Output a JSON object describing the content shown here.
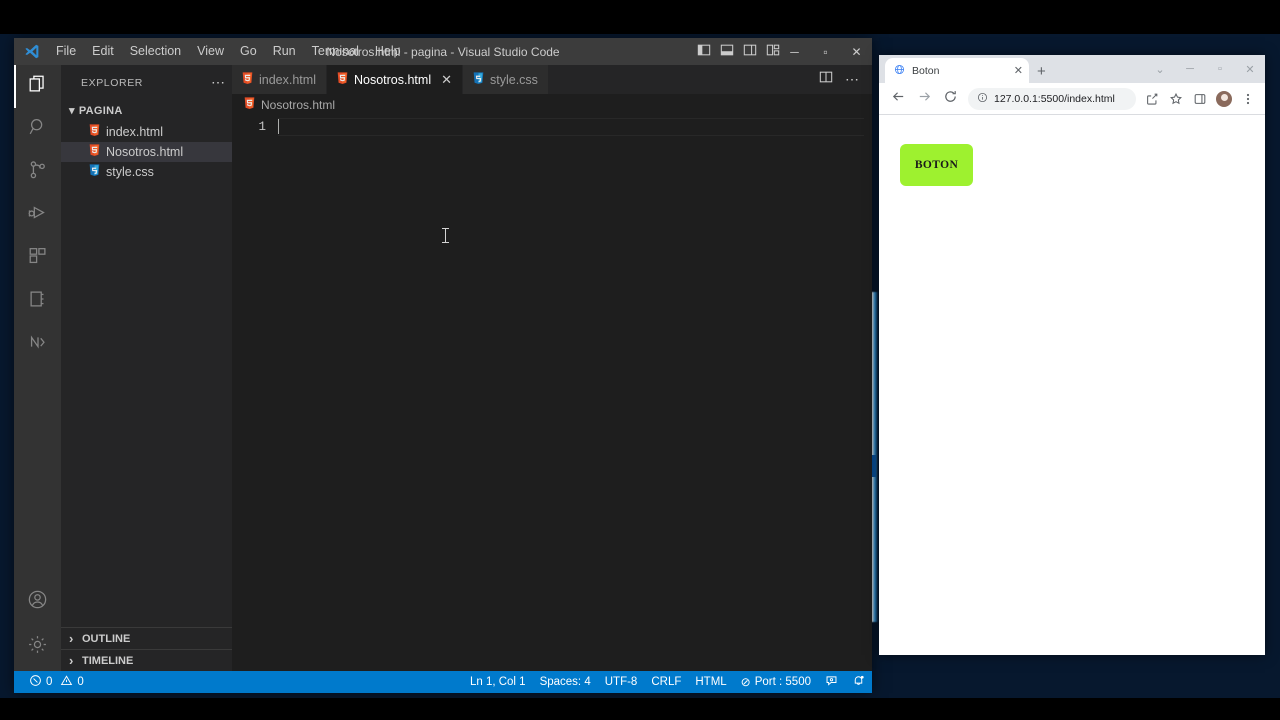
{
  "desktop": {
    "name": "windows-desktop"
  },
  "vscode": {
    "title": "Nosotros.html - pagina - Visual Studio Code",
    "logo_icon": "vscode-logo-icon",
    "menu": [
      {
        "label": "File"
      },
      {
        "label": "Edit"
      },
      {
        "label": "Selection"
      },
      {
        "label": "View"
      },
      {
        "label": "Go"
      },
      {
        "label": "Run"
      },
      {
        "label": "Terminal"
      },
      {
        "label": "Help"
      }
    ],
    "layout_icons": [
      {
        "name": "toggle-primary-sidebar-icon"
      },
      {
        "name": "toggle-panel-icon"
      },
      {
        "name": "toggle-secondary-sidebar-icon"
      },
      {
        "name": "customize-layout-icon"
      }
    ],
    "window_controls": {
      "minimize": "─",
      "maximize": "▫",
      "close": "✕"
    },
    "activitybar": [
      {
        "name": "explorer",
        "icon": "files-icon",
        "active": true
      },
      {
        "name": "search",
        "icon": "search-icon",
        "active": false
      },
      {
        "name": "source-control",
        "icon": "source-control-icon",
        "active": false
      },
      {
        "name": "run-and-debug",
        "icon": "run-debug-icon",
        "active": false
      },
      {
        "name": "extensions",
        "icon": "extensions-icon",
        "active": false
      },
      {
        "name": "notebook",
        "icon": "notebook-icon",
        "active": false
      },
      {
        "name": "nodejs-tool",
        "icon": "n-icon",
        "active": false
      }
    ],
    "activitybar_bottom": [
      {
        "name": "accounts",
        "icon": "account-icon"
      },
      {
        "name": "manage-settings",
        "icon": "gear-icon"
      }
    ],
    "sidebar": {
      "header": "EXPLORER",
      "header_more_icon": "ellipsis-icon",
      "folder": {
        "label": "PAGINA",
        "chevron": "⌄"
      },
      "files": [
        {
          "label": "index.html",
          "icon": "html5-icon",
          "selected": false
        },
        {
          "label": "Nosotros.html",
          "icon": "html5-icon",
          "selected": true
        },
        {
          "label": "style.css",
          "icon": "css3-icon",
          "selected": false
        }
      ],
      "sections": [
        {
          "label": "OUTLINE",
          "chevron": "›"
        },
        {
          "label": "TIMELINE",
          "chevron": "›"
        }
      ]
    },
    "editor": {
      "tabs": [
        {
          "label": "index.html",
          "icon": "html5-icon",
          "active": false,
          "close": ""
        },
        {
          "label": "Nosotros.html",
          "icon": "html5-icon",
          "active": true,
          "close": "✕"
        },
        {
          "label": "style.css",
          "icon": "css3-icon",
          "active": false,
          "close": ""
        }
      ],
      "actions": [
        {
          "name": "split-editor-right-icon"
        },
        {
          "name": "more-actions-icon"
        }
      ],
      "breadcrumb": {
        "label": "Nosotros.html",
        "icon": "html5-icon"
      },
      "line_numbers": [
        "1"
      ],
      "content_lines": [
        ""
      ]
    },
    "statusbar": {
      "errors_icon": "error-circle-icon",
      "errors": "0",
      "warnings_icon": "warning-triangle-icon",
      "warnings": "0",
      "cursor_position": "Ln 1, Col 1",
      "indentation": "Spaces: 4",
      "encoding": "UTF-8",
      "eol": "CRLF",
      "language": "HTML",
      "live_server_icon": "⊘",
      "live_server": "Port : 5500",
      "feedback_icon": "feedback-icon",
      "bell_icon": "bell-dot-icon",
      "accent_color": "#007acc"
    }
  },
  "browser": {
    "tab": {
      "title": "Boton",
      "favicon": "globe-icon",
      "close": "✕"
    },
    "new_tab_label": "+",
    "window_controls": {
      "tab_search": "⌄",
      "minimize": "─",
      "maximize": "▫",
      "close": "✕"
    },
    "nav": {
      "back_icon": "arrow-left-icon",
      "forward_icon": "arrow-right-icon",
      "reload_icon": "reload-icon"
    },
    "omnibox": {
      "info_icon": "info-circle-icon",
      "url": "127.0.0.1:5500/index.html"
    },
    "toolbar_icons": [
      {
        "name": "share-icon"
      },
      {
        "name": "bookmark-star-icon"
      },
      {
        "name": "side-panel-icon"
      },
      {
        "name": "profile-avatar-icon"
      },
      {
        "name": "chrome-menu-icon"
      }
    ],
    "page": {
      "button_label": "BOTON",
      "button_color": "#9EF12F",
      "background": "#ffffff"
    }
  }
}
